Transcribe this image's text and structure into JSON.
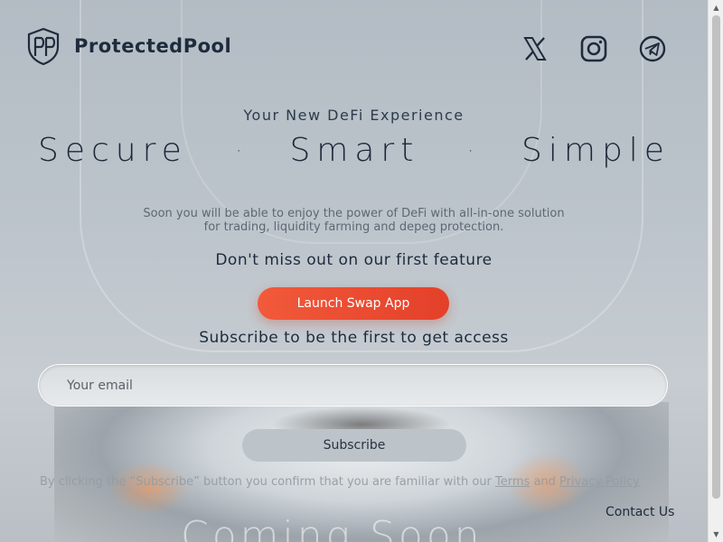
{
  "header": {
    "brand": "ProtectedPool",
    "social": [
      {
        "name": "x-icon",
        "label": "X"
      },
      {
        "name": "instagram-icon",
        "label": "Instagram"
      },
      {
        "name": "telegram-icon",
        "label": "Telegram"
      }
    ]
  },
  "hero": {
    "tagline": "Your New DeFi Experience",
    "words": [
      "Secure",
      "Smart",
      "Simple"
    ],
    "separator": "·",
    "description_line1": "Soon you will be able to enjoy the power of DeFi with all-in-one solution",
    "description_line2": "for trading, liquidity farming and depeg protection.",
    "feature_text": "Don't miss out on our first feature",
    "launch_label": "Launch Swap App"
  },
  "subscribe": {
    "heading": "Subscribe to be the first to get access",
    "email_placeholder": "Your email",
    "button_label": "Subscribe",
    "consent_prefix": "By clicking the “Subscribe” button you confirm that you are familiar with our ",
    "terms_label": "Terms",
    "consent_and": " and ",
    "privacy_label": "Privacy Policy"
  },
  "footer": {
    "contact_label": "Contact Us",
    "coming_soon": "Coming Soon"
  },
  "colors": {
    "accent": "#ec4a30",
    "text_dark": "#1e2b3c"
  }
}
